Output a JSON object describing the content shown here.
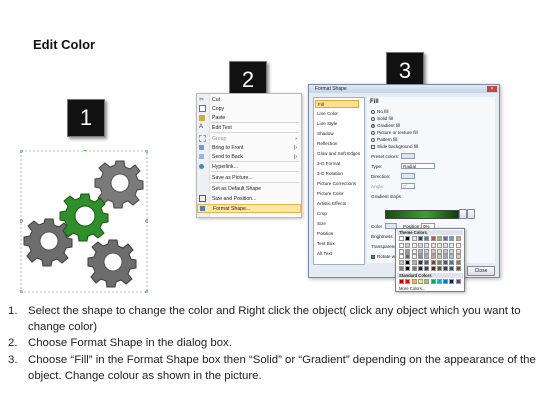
{
  "title": "Edit Color",
  "steps": [
    "1",
    "2",
    "3"
  ],
  "context_menu": {
    "items": [
      {
        "label": "Cut",
        "disabled": false,
        "selected": false,
        "arrow": false
      },
      {
        "label": "Copy",
        "disabled": false,
        "selected": false,
        "arrow": false
      },
      {
        "label": "Paste",
        "disabled": false,
        "selected": false,
        "arrow": false
      },
      {
        "label": "Edit Text",
        "disabled": false,
        "selected": false,
        "arrow": false
      },
      {
        "label": "Group",
        "disabled": true,
        "selected": false,
        "arrow": true
      },
      {
        "label": "Bring to Front",
        "disabled": false,
        "selected": false,
        "arrow": true
      },
      {
        "label": "Send to Back",
        "disabled": false,
        "selected": false,
        "arrow": true
      },
      {
        "label": "Hyperlink...",
        "disabled": false,
        "selected": false,
        "arrow": false
      },
      {
        "label": "Save as Picture...",
        "disabled": false,
        "selected": false,
        "arrow": false
      },
      {
        "label": "Set as Default Shape",
        "disabled": false,
        "selected": false,
        "arrow": false
      },
      {
        "label": "Size and Position...",
        "disabled": false,
        "selected": false,
        "arrow": false
      },
      {
        "label": "Format Shape...",
        "disabled": false,
        "selected": true,
        "arrow": false
      }
    ]
  },
  "dialog": {
    "title": "Format Shape",
    "categories": [
      "Fill",
      "Line Color",
      "Line Style",
      "Shadow",
      "Reflection",
      "Glow and Soft Edges",
      "3-D Format",
      "3-D Rotation",
      "Picture Corrections",
      "Picture Color",
      "Artistic Effects",
      "Crop",
      "Size",
      "Position",
      "Text Box",
      "Alt Text"
    ],
    "selected_category": "Fill",
    "fill": {
      "heading": "Fill",
      "options": [
        "No fill",
        "Solid fill",
        "Gradient fill",
        "Picture or texture fill",
        "Pattern fill",
        "Slide background fill"
      ],
      "selected_option": "Gradient fill",
      "preset_label": "Preset colors:",
      "type_label": "Type:",
      "type_value": "Radial",
      "direction_label": "Direction:",
      "angle_label": "Angle:",
      "angle_value": "0°",
      "gradient_stops_label": "Gradient stops",
      "color_label": "Color",
      "position_label": "Position:",
      "position_value": "0%",
      "brightness_label": "Brightness",
      "transparency_label": "Transparency",
      "rotate_label": "Rotate with shape"
    },
    "close_label": "Close"
  },
  "palette": {
    "theme_heading": "Theme Colors",
    "standard_heading": "Standard Colors",
    "more_label": "More Colors...",
    "theme_top": [
      "#ffffff",
      "#000000",
      "#eeece1",
      "#1f497d",
      "#4f81bd",
      "#c0504d",
      "#9bbb59",
      "#8064a2",
      "#4bacc6",
      "#f79646"
    ],
    "standard": [
      "#c00000",
      "#ff0000",
      "#ffc000",
      "#ffff00",
      "#92d050",
      "#00b050",
      "#00b0f0",
      "#0070c0",
      "#002060",
      "#7030a0"
    ]
  },
  "colors": {
    "gear_gray": "#6d6d6d",
    "gear_green": "#2f8f2a",
    "highlight": "#ffe6a6"
  },
  "instructions": [
    {
      "num": "1.",
      "text": "Select the shape to change the color and Right click the object( click any object which you want to change color)"
    },
    {
      "num": "2.",
      "text": "Choose Format Shape in the dialog box."
    },
    {
      "num": "3.",
      "text": "Choose “Fill” in the Format Shape box then “Solid” or “Gradient” depending on the appearance of the object. Change colour as shown in the picture."
    }
  ]
}
